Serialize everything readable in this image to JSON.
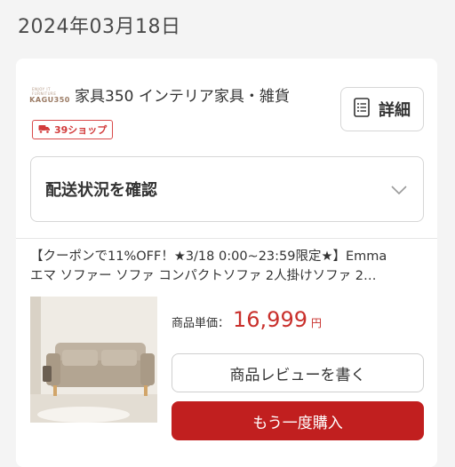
{
  "order": {
    "date": "2024年03月18日"
  },
  "shop": {
    "logo_tiny": "ENJOY IT FURNITURE",
    "logo_text": "KAGU350",
    "name": "家具350 インテリア家具・雑貨",
    "badge_label": "39ショップ",
    "detail_label": "詳細"
  },
  "shipping": {
    "status_label": "配送状況を確認"
  },
  "product": {
    "title_line1": "【クーポンで11%OFF！★3/18 0:00~23:59限定★】Emma",
    "title_line2": "エマ ソファー ソファ コンパクトソファ 2人掛けソファ 2…",
    "price_label": "商品単価：",
    "price_value": "16,999",
    "price_unit": "円"
  },
  "actions": {
    "review_label": "商品レビューを書く",
    "rebuy_label": "もう一度購入"
  },
  "colors": {
    "accent": "#c11f1f",
    "price": "#c9302c",
    "badge": "#d23b3b"
  }
}
